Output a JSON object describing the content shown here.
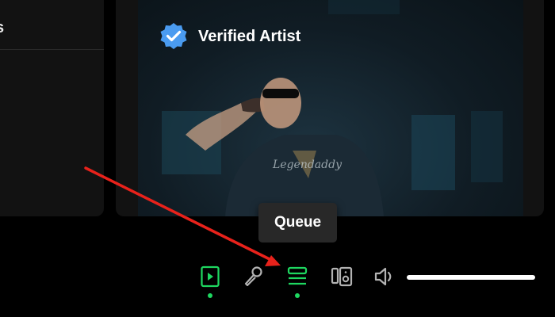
{
  "left_panel": {
    "partial_text": "s"
  },
  "artist_card": {
    "verified_label": "Verified Artist",
    "photo_caption": "Legendaddy"
  },
  "tooltip": {
    "text": "Queue"
  },
  "controls": [
    {
      "name": "now-playing-view",
      "icon": "now-playing-icon",
      "active": true
    },
    {
      "name": "lyrics",
      "icon": "microphone-icon",
      "active": false
    },
    {
      "name": "queue",
      "icon": "queue-icon",
      "active": true
    },
    {
      "name": "connect-device",
      "icon": "speaker-device-icon",
      "active": false
    },
    {
      "name": "mute",
      "icon": "volume-icon",
      "active": false
    }
  ],
  "volume": {
    "level": 1.0
  },
  "colors": {
    "accent": "#1ed760",
    "verified_badge": "#4a9bf0",
    "annotation_arrow": "#e8221b"
  }
}
